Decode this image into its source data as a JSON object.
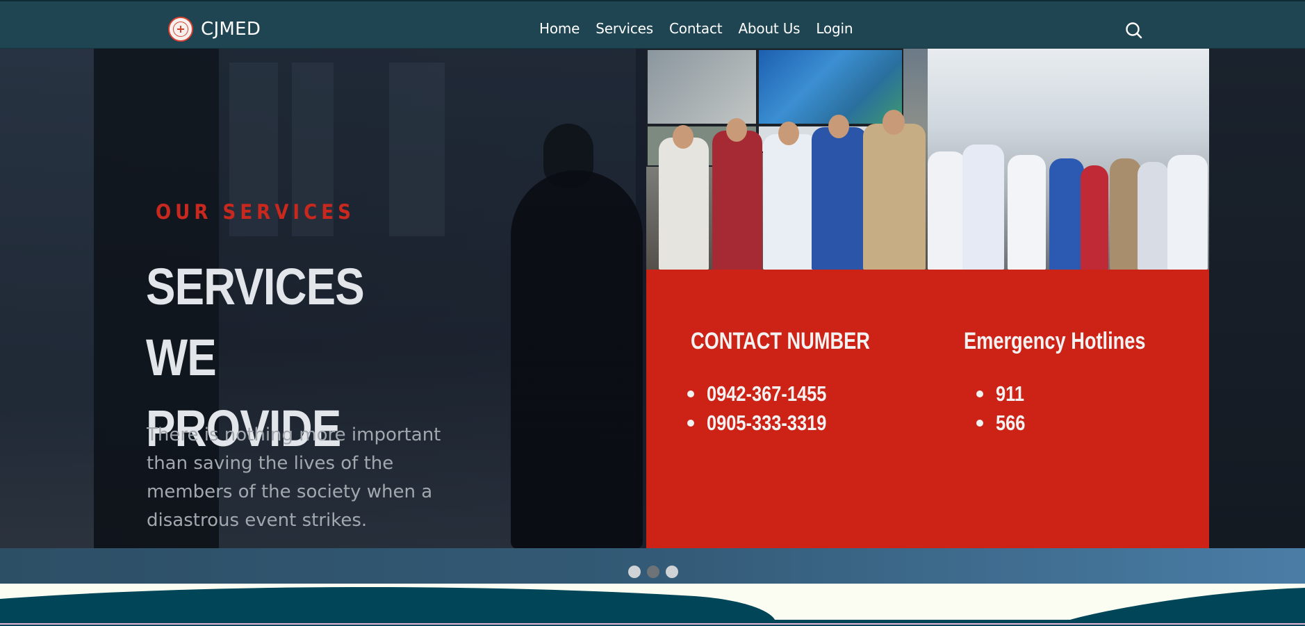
{
  "brand": {
    "name": "CJMED",
    "logo_icon": "cjmed-logo-icon"
  },
  "nav": {
    "links": [
      "Home",
      "Services",
      "Contact",
      "About Us",
      "Login"
    ],
    "search_icon": "search-icon"
  },
  "hero": {
    "eyebrow": "OUR SERVICES",
    "title": "SERVICES WE PROVIDE",
    "description": "There is nothing more important than saving the lives of the members of the society when a disastrous event strikes."
  },
  "contacts": {
    "contact_title": "CONTACT NUMBER",
    "contact_numbers": [
      "0942-367-1455",
      "0905-333-3319"
    ],
    "hotline_title": "Emergency Hotlines",
    "hotlines": [
      "911",
      "566"
    ]
  },
  "slider": {
    "count": 3,
    "active_index": 1
  },
  "colors": {
    "navbar": "#1f4552",
    "accent_red": "#cd2316",
    "eyebrow_red": "#c8281e",
    "wave_teal": "#004658",
    "wave_bg": "#fcfdf2"
  }
}
